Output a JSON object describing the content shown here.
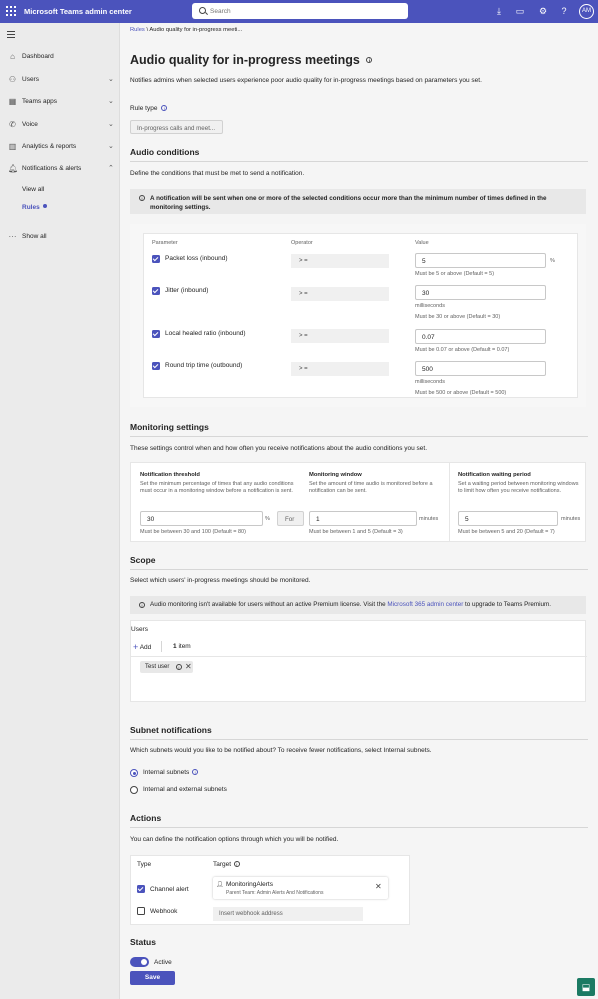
{
  "app": {
    "title": "Microsoft Teams admin center",
    "search_placeholder": "Search",
    "avatar_initials": "AM"
  },
  "nav": {
    "items": [
      {
        "label": "Dashboard",
        "icon": "home-icon"
      },
      {
        "label": "Users",
        "icon": "users-icon"
      },
      {
        "label": "Teams apps",
        "icon": "apps-icon"
      },
      {
        "label": "Voice",
        "icon": "phone-icon"
      },
      {
        "label": "Analytics & reports",
        "icon": "chart-icon"
      },
      {
        "label": "Notifications & alerts",
        "icon": "bell-icon"
      }
    ],
    "sub_items": [
      "View all",
      "Rules"
    ],
    "show_all": "Show all"
  },
  "breadcrumb": {
    "parent": "Rules",
    "separator": "\\",
    "current": "Audio quality for in-progress meeti..."
  },
  "page": {
    "title": "Audio quality for in-progress meetings",
    "description": "Notifies admins when selected users experience poor audio quality for in-progress meetings based on parameters you set.",
    "rule_type_label": "Rule type",
    "rule_type_value": "In-progress calls and meet..."
  },
  "audio_conditions": {
    "heading": "Audio conditions",
    "description": "Define the conditions that must be met to send a notification.",
    "info": "A notification will be sent when one or more of the selected conditions occur more than the minimum number of times defined in the monitoring settings.",
    "col_parameter": "Parameter",
    "col_operator": "Operator",
    "col_value": "Value",
    "rows": [
      {
        "parameter": "Packet loss (inbound)",
        "operator": "> =",
        "value": "5",
        "unit": "%",
        "unit_below": "",
        "hint": "Must be 5 or above (Default = 5)"
      },
      {
        "parameter": "Jitter (inbound)",
        "operator": "> =",
        "value": "30",
        "unit": "",
        "unit_below": "milliseconds",
        "hint": "Must be 30 or above (Default = 30)"
      },
      {
        "parameter": "Local healed ratio (inbound)",
        "operator": "> =",
        "value": "0.07",
        "unit": "",
        "unit_below": "",
        "hint": "Must be 0.07 or above (Default = 0.07)"
      },
      {
        "parameter": "Round trip time (outbound)",
        "operator": "> =",
        "value": "500",
        "unit": "",
        "unit_below": "milliseconds",
        "hint": "Must be 500 or above (Default = 500)"
      }
    ]
  },
  "monitoring": {
    "heading": "Monitoring settings",
    "description": "These settings control when and how often you receive notifications about the audio conditions you set.",
    "threshold": {
      "title": "Notification threshold",
      "desc": "Set the minimum percentage of times that any audio conditions must occur in a monitoring window before a notification is sent.",
      "value": "30",
      "unit": "%",
      "hint": "Must be between 30 and 100 (Default = 80)"
    },
    "for_label": "For",
    "window": {
      "title": "Monitoring window",
      "desc": "Set the amount of time audio is monitored before a notification can be sent.",
      "value": "1",
      "unit": "minutes",
      "hint": "Must be between 1 and 5 (Default = 3)"
    },
    "waiting": {
      "title": "Notification waiting period",
      "desc": "Set a waiting period between monitoring windows to limit how often you receive notifications.",
      "value": "5",
      "unit": "minutes",
      "hint": "Must be between 5 and 20 (Default = 7)"
    }
  },
  "scope": {
    "heading": "Scope",
    "description": "Select which users' in-progress meetings should be monitored.",
    "info_before": "Audio monitoring isn't available for users without an active Premium license. Visit the ",
    "info_link": "Microsoft 365 admin center",
    "info_after": " to upgrade to Teams Premium.",
    "users_label": "Users",
    "add_label": "Add",
    "count_number": "1",
    "count_label": "item",
    "user_chip": "Test user"
  },
  "subnet": {
    "heading": "Subnet notifications",
    "description": "Which subnets would you like to be notified about? To receive fewer notifications, select Internal subnets.",
    "options": [
      "Internal subnets",
      "Internal and external subnets"
    ]
  },
  "actions": {
    "heading": "Actions",
    "description": "You can define the notification options through which you will be notified.",
    "col_type": "Type",
    "col_target": "Target",
    "channel_label": "Channel alert",
    "webhook_label": "Webhook",
    "target_name": "MonitoringAlerts",
    "target_parent": "Parent Team: Admin Alerts And Notifications",
    "webhook_placeholder": "Insert webhook address"
  },
  "status": {
    "heading": "Status",
    "toggle_label": "Active",
    "save_label": "Save"
  }
}
